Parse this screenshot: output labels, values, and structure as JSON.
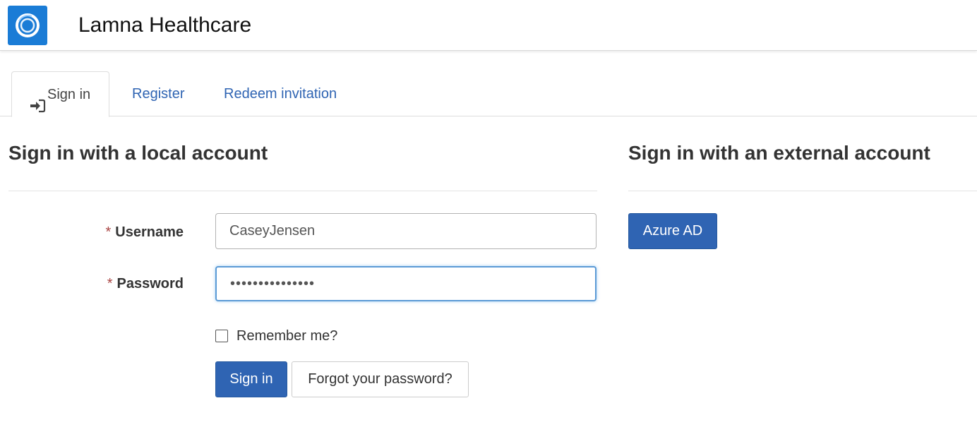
{
  "header": {
    "brand": "Lamna Healthcare",
    "logo_icon": "ring-logo-icon",
    "logo_color": "#1a7cd6"
  },
  "tabs": [
    {
      "label": "Sign in",
      "icon": "sign-in-icon",
      "active": true
    },
    {
      "label": "Register",
      "active": false
    },
    {
      "label": "Redeem invitation",
      "active": false
    }
  ],
  "local": {
    "heading": "Sign in with a local account",
    "required_marker": "*",
    "username_label": "Username",
    "username_value": "CaseyJensen",
    "password_label": "Password",
    "password_value": "•••••••••••••••",
    "remember_label": "Remember me?",
    "remember_checked": false,
    "signin_button": "Sign in",
    "forgot_button": "Forgot your password?"
  },
  "external": {
    "heading": "Sign in with an external account",
    "providers": [
      {
        "label": "Azure AD"
      }
    ]
  },
  "colors": {
    "primary": "#2f64b3",
    "required": "#a94442",
    "focus_border": "#5b9ad6"
  }
}
